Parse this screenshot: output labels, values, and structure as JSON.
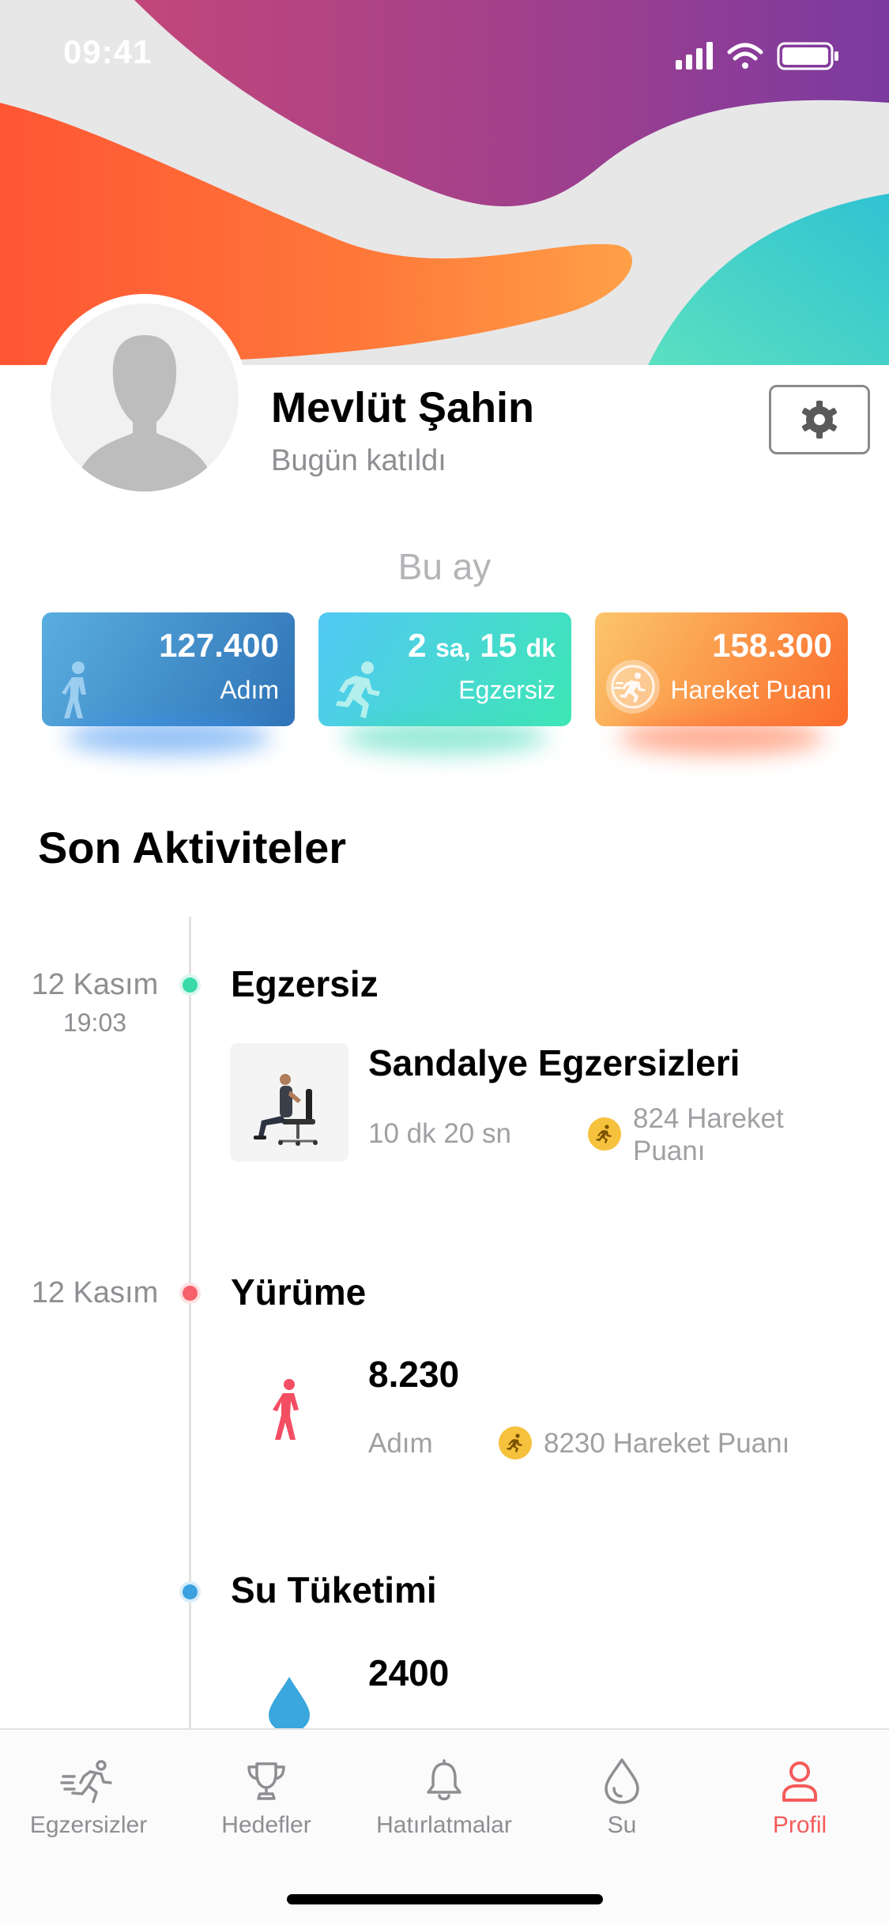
{
  "status_bar": {
    "time": "09:41"
  },
  "profile": {
    "name": "Mevlüt Şahin",
    "joined": "Bugün katıldı"
  },
  "stats": {
    "period_label": "Bu ay",
    "steps": {
      "value": "127.400",
      "label": "Adım"
    },
    "exercise": {
      "hours": "2",
      "hours_unit": "sa,",
      "minutes": "15",
      "minutes_unit": "dk",
      "label": "Egzersiz"
    },
    "points": {
      "value": "158.300",
      "label": "Hareket Puanı"
    }
  },
  "activities": {
    "title": "Son Aktiviteler",
    "items": [
      {
        "date": "12 Kasım",
        "time": "19:03",
        "category": "Egzersiz",
        "name": "Sandalye Egzersizleri",
        "duration": "10 dk 20 sn",
        "points_line1": "824 Hareket",
        "points_line2": "Puanı",
        "dot_color": "#39d9a8"
      },
      {
        "date": "12 Kasım",
        "category": "Yürüme",
        "value": "8.230",
        "unit": "Adım",
        "points": "8230 Hareket Puanı",
        "dot_color": "#f5606a"
      },
      {
        "category": "Su Tüketimi",
        "value": "2400",
        "dot_color": "#3aa0e0"
      }
    ]
  },
  "tabbar": {
    "tabs": [
      {
        "label": "Egzersizler",
        "icon": "running-icon"
      },
      {
        "label": "Hedefler",
        "icon": "trophy-icon"
      },
      {
        "label": "Hatırlatmalar",
        "icon": "bell-icon"
      },
      {
        "label": "Su",
        "icon": "water-drop-icon"
      },
      {
        "label": "Profil",
        "icon": "person-icon",
        "active": true
      }
    ]
  },
  "colors": {
    "accent": "#f45b5b",
    "steps_card": "#2f73b6",
    "exercise_card": "#3ee6b5",
    "points_card": "#fb6b2a"
  }
}
